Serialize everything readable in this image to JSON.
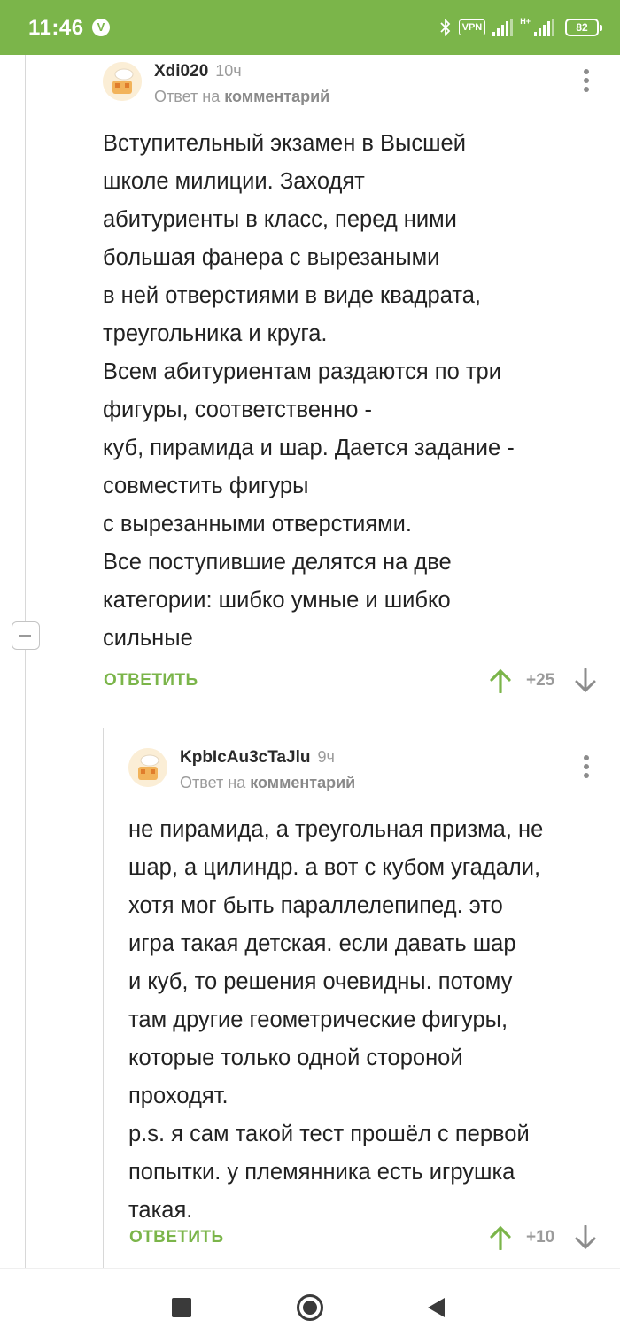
{
  "status_bar": {
    "time": "11:46",
    "badge": "V",
    "vpn": "VPN",
    "network": "H+",
    "battery": "82"
  },
  "comments": [
    {
      "author": "Xdi020",
      "time": "10ч",
      "reply_prefix": "Ответ на",
      "reply_link": "комментарий",
      "body_lines": [
        "Вступительный экзамен в Высшей",
        "школе милиции. Заходят",
        "абитуриенты в класс, перед ними",
        "большая фанера с вырезаными",
        "в ней отверстиями в виде квадрата,",
        "треугольника и круга.",
        "Всем абитуриентам раздаются по три",
        "фигуры, соответственно -",
        "куб, пирамида и шар. Дается задание -",
        "совместить фигуры",
        "с вырезанными отверстиями.",
        "Все поступившие делятся на две",
        "категории: шибко умные и шибко",
        "сильные"
      ],
      "reply_label": "ОТВЕТИТЬ",
      "rating": "+25"
    },
    {
      "author": "KpbIcAu3cTaJlu",
      "time": "9ч",
      "reply_prefix": "Ответ на",
      "reply_link": "комментарий",
      "body_lines": [
        "не пирамида, а треугольная призма, не",
        "шар, а цилиндр. а вот с кубом угадали,",
        "хотя мог быть параллелепипед. это",
        "игра такая детская. если давать шар",
        "и куб, то решения очевидны. потому",
        "там другие геометрические фигуры,",
        "которые только одной стороной",
        "проходят.",
        " p.s. я сам такой тест прошёл с первой",
        "попытки. у племянника есть игрушка",
        "такая."
      ],
      "reply_label": "ОТВЕТИТЬ",
      "rating": "+10"
    }
  ],
  "colors": {
    "accent": "#7bb54a",
    "muted": "#9b9b9b"
  },
  "icons": [
    "bluetooth-icon",
    "signal-icon",
    "battery-icon",
    "more-vert-icon",
    "arrow-up-icon",
    "arrow-down-icon",
    "collapse-icon",
    "nav-recents-icon",
    "nav-home-icon",
    "nav-back-icon"
  ]
}
